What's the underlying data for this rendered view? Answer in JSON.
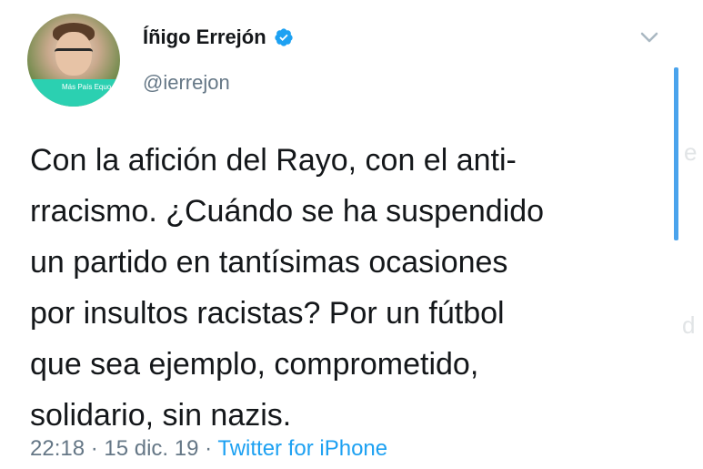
{
  "author": {
    "display_name": "Íñigo Errejón",
    "handle": "@ierrejon",
    "avatar_badge": "Más País Equo"
  },
  "tweet": {
    "text": "Con la afición del Rayo, con el anti-\nrracismo. ¿Cuándo se ha suspendido\nun partido en tantísimas ocasiones\npor insultos racistas? Por un fútbol\nque sea ejemplo, comprometido,\nsolidario, sin nazis.",
    "time": "22:18",
    "date": "15 dic. 19",
    "separator": " · ",
    "source": "Twitter for iPhone"
  },
  "icons": {
    "verified": "verified-badge-icon",
    "menu": "chevron-down-icon"
  },
  "colors": {
    "link_blue": "#1da1f2",
    "secondary_text": "#657786",
    "primary_text": "#14171a",
    "badge_green": "#2bd0b1"
  }
}
